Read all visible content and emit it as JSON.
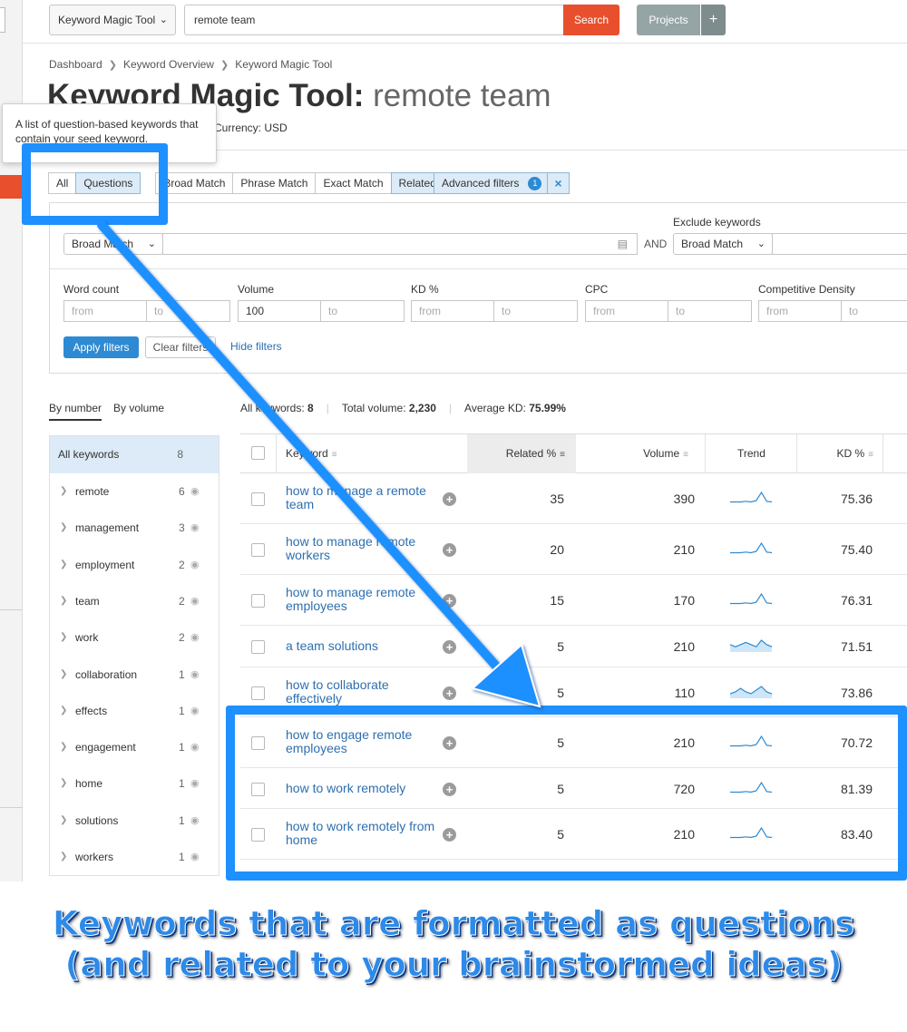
{
  "topbar": {
    "tool_select": "Keyword Magic Tool",
    "search_value": "remote team",
    "search_button": "Search",
    "projects_button": "Projects",
    "projects_plus": "+"
  },
  "breadcrumb": [
    "Dashboard",
    "Keyword Overview",
    "Keyword Magic Tool"
  ],
  "title": {
    "prefix": "Keyword Magic Tool:",
    "keyword": "remote team"
  },
  "currency": "Currency: USD",
  "tooltip": "A list of question-based keywords that contain your seed keyword.",
  "tabs": [
    "All",
    "Questions",
    "Broad Match",
    "Phrase Match",
    "Exact Match",
    "Related"
  ],
  "active_tabs": [
    "Questions",
    "Related"
  ],
  "advanced_filters": {
    "label": "Advanced filters",
    "count": "1",
    "close": "×"
  },
  "filters": {
    "exclude_label": "Exclude keywords",
    "include_match": "Broad Match",
    "exclude_match": "Broad Match",
    "and_label": "AND",
    "word_count": {
      "label": "Word count",
      "from": "from",
      "to": "to"
    },
    "volume": {
      "label": "Volume",
      "from": "100",
      "to": "to"
    },
    "kd": {
      "label": "KD %",
      "from": "from",
      "to": "to"
    },
    "cpc": {
      "label": "CPC",
      "from": "from",
      "to": "to"
    },
    "competitive_density": {
      "label": "Competitive Density",
      "from": "from",
      "to": "to"
    },
    "apply": "Apply filters",
    "clear": "Clear filters",
    "hide": "Hide filters"
  },
  "group_tabs": {
    "by_number": "By number",
    "by_volume": "By volume"
  },
  "groups": {
    "all": {
      "label": "All keywords",
      "count": "8"
    },
    "items": [
      {
        "name": "remote",
        "count": "6"
      },
      {
        "name": "management",
        "count": "3"
      },
      {
        "name": "employment",
        "count": "2"
      },
      {
        "name": "team",
        "count": "2"
      },
      {
        "name": "work",
        "count": "2"
      },
      {
        "name": "collaboration",
        "count": "1"
      },
      {
        "name": "effects",
        "count": "1"
      },
      {
        "name": "engagement",
        "count": "1"
      },
      {
        "name": "home",
        "count": "1"
      },
      {
        "name": "solutions",
        "count": "1"
      },
      {
        "name": "workers",
        "count": "1"
      }
    ]
  },
  "stats": {
    "all_keywords_label": "All keywords:",
    "all_keywords": "8",
    "total_volume_label": "Total volume:",
    "total_volume": "2,230",
    "average_kd_label": "Average KD:",
    "average_kd": "75.99%"
  },
  "table": {
    "columns": [
      "Keyword",
      "Related %",
      "Volume",
      "Trend",
      "KD %"
    ],
    "rows": [
      {
        "keyword": "how to manage a remote team",
        "related": "35",
        "volume": "390",
        "kd": "75.36",
        "trend": [
          1,
          1,
          1,
          1.5,
          1,
          2,
          8,
          1.5,
          1
        ]
      },
      {
        "keyword": "how to manage remote workers",
        "related": "20",
        "volume": "210",
        "kd": "75.40",
        "trend": [
          1,
          1,
          1,
          1.5,
          1,
          2,
          8,
          1.5,
          1
        ]
      },
      {
        "keyword": "how to manage remote employees",
        "related": "15",
        "volume": "170",
        "kd": "76.31",
        "trend": [
          1,
          1,
          1,
          1.5,
          1,
          2,
          8,
          1.5,
          1
        ]
      },
      {
        "keyword": "a team solutions",
        "related": "5",
        "volume": "210",
        "kd": "71.51",
        "trend": [
          3,
          2,
          3,
          4,
          3,
          2,
          5,
          3,
          2
        ],
        "area": true
      },
      {
        "keyword": "how to collaborate effectively",
        "related": "5",
        "volume": "110",
        "kd": "73.86",
        "trend": [
          2,
          3,
          5,
          3,
          2,
          4,
          6,
          3,
          2
        ],
        "area": true
      },
      {
        "keyword": "how to engage remote employees",
        "related": "5",
        "volume": "210",
        "kd": "70.72",
        "trend": [
          1,
          1,
          1,
          1.5,
          1,
          2,
          8,
          1.5,
          1
        ]
      },
      {
        "keyword": "how to work remotely",
        "related": "5",
        "volume": "720",
        "kd": "81.39",
        "trend": [
          1,
          1,
          1,
          1.5,
          1,
          2,
          8,
          1.5,
          1
        ]
      },
      {
        "keyword": "how to work remotely from home",
        "related": "5",
        "volume": "210",
        "kd": "83.40",
        "trend": [
          1,
          1,
          1,
          1.5,
          1,
          2,
          8,
          1.5,
          1
        ]
      }
    ]
  },
  "caption": {
    "line1": "Keywords that are formatted as questions",
    "line2": "(and related to your brainstormed ideas)"
  },
  "colors": {
    "accent_blue": "#2d8ad3",
    "annotation_blue": "#1e90ff",
    "search_orange": "#e8502d",
    "link_blue": "#2d6fb0"
  }
}
